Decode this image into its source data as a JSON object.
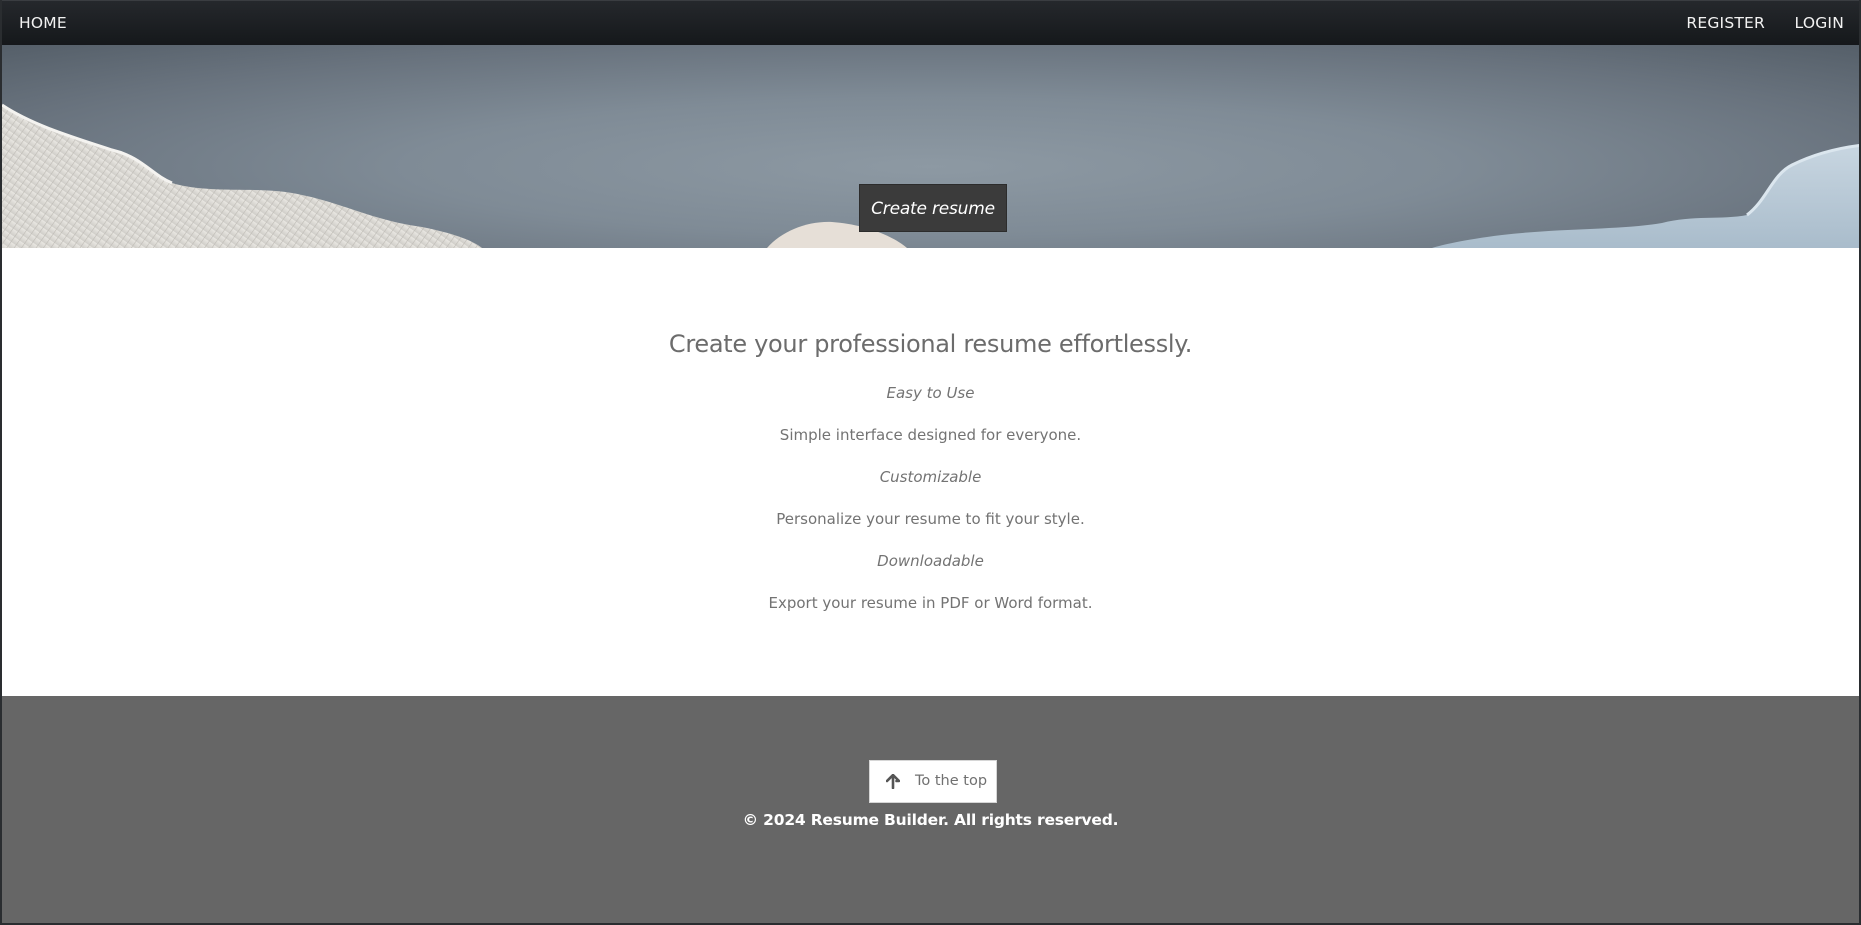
{
  "nav": {
    "home": "HOME",
    "register": "REGISTER",
    "login": "LOGIN"
  },
  "hero": {
    "cta": "Create resume"
  },
  "main": {
    "tagline": "Create your professional resume effortlessly.",
    "features": [
      {
        "title": "Easy to Use",
        "description": "Simple interface designed for everyone."
      },
      {
        "title": "Customizable",
        "description": "Personalize your resume to fit your style."
      },
      {
        "title": "Downloadable",
        "description": "Export your resume in PDF or Word format."
      }
    ]
  },
  "footer": {
    "to_top": "To the top",
    "to_top_icon": "arrow-up-icon",
    "copyright": "© 2024 Resume Builder. All rights reserved."
  },
  "colors": {
    "navbar": "#1c1f22",
    "cta_background": "#3b3b3b",
    "footer_background": "#666666",
    "body_text": "#707070"
  }
}
